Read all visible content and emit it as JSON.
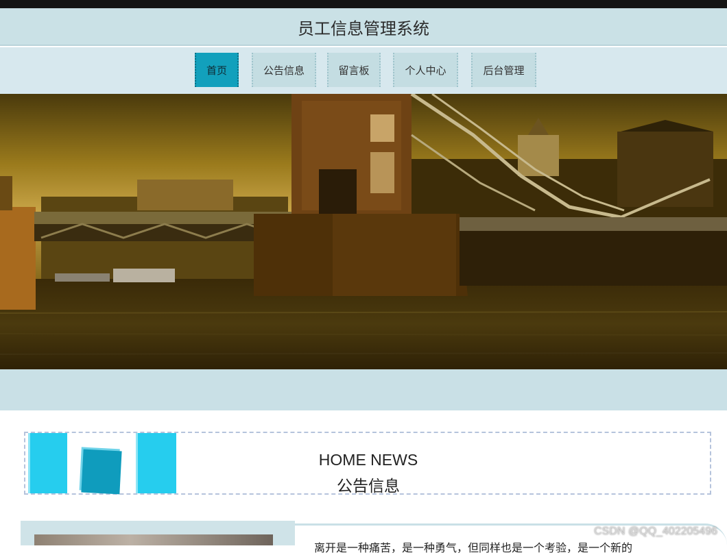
{
  "header": {
    "title": "员工信息管理系统"
  },
  "nav": {
    "items": [
      {
        "label": "首页",
        "active": true
      },
      {
        "label": "公告信息",
        "active": false
      },
      {
        "label": "留言板",
        "active": false
      },
      {
        "label": "个人中心",
        "active": false
      },
      {
        "label": "后台管理",
        "active": false
      }
    ]
  },
  "banner": {
    "subject": "tower-bridge-photo"
  },
  "news": {
    "heading_en": "HOME NEWS",
    "heading_cn": "公告信息"
  },
  "article": {
    "excerpt": "离开是一种痛苦，是一种勇气，但同样也是一个考验，是一个新的"
  },
  "watermark": "CSDN @QQ_402205496",
  "colors": {
    "accent": "#12a0bc",
    "nav_bg": "#d7e8ee",
    "title_bg": "#cae1e6",
    "deco": "#26cdee"
  }
}
